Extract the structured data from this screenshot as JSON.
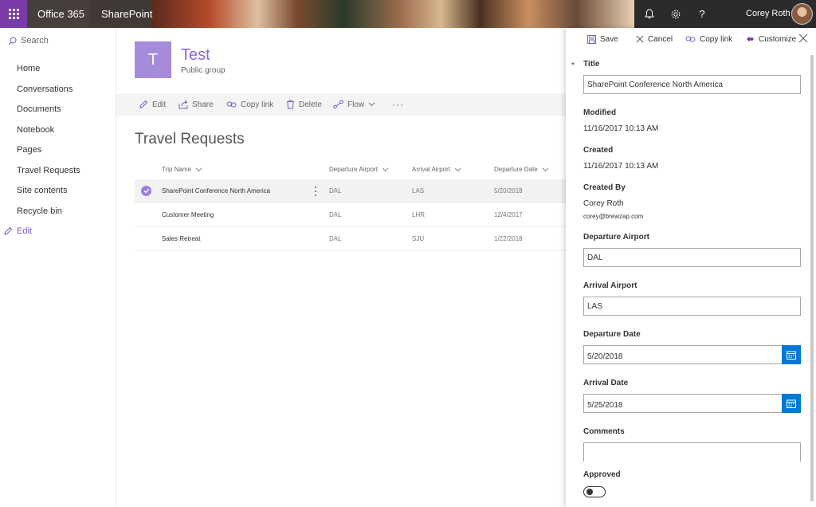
{
  "suite": {
    "brand": "Office 365",
    "app": "SharePoint",
    "user_name": "Corey Roth",
    "icons": [
      "waffle-icon",
      "bell-icon",
      "gear-icon",
      "help-icon"
    ]
  },
  "leftnav": {
    "search_label": "Search",
    "items": [
      {
        "label": "Home"
      },
      {
        "label": "Conversations"
      },
      {
        "label": "Documents"
      },
      {
        "label": "Notebook"
      },
      {
        "label": "Pages"
      },
      {
        "label": "Travel Requests"
      },
      {
        "label": "Site contents"
      },
      {
        "label": "Recycle bin"
      }
    ],
    "edit_label": "Edit"
  },
  "site": {
    "logo_letter": "T",
    "title": "Test",
    "subtitle": "Public group"
  },
  "commandbar": {
    "edit": "Edit",
    "share": "Share",
    "copy_link": "Copy link",
    "delete": "Delete",
    "flow": "Flow",
    "more": "···"
  },
  "list": {
    "title": "Travel Requests",
    "columns": [
      "Trip Name",
      "Departure Airport",
      "Arrival Airport",
      "Departure Date"
    ],
    "rows": [
      {
        "name": "SharePoint Conference North America",
        "departure": "DAL",
        "arrival": "LAS",
        "date": "5/20/2018",
        "selected": true
      },
      {
        "name": "Customer Meeting",
        "departure": "DAL",
        "arrival": "LHR",
        "date": "12/4/2017",
        "selected": false
      },
      {
        "name": "Sales Retreat",
        "departure": "DAL",
        "arrival": "SJU",
        "date": "1/22/2018",
        "selected": false
      }
    ]
  },
  "panel": {
    "commands": {
      "save": "Save",
      "cancel": "Cancel",
      "copy_link": "Copy link",
      "customize": "Customize"
    },
    "required_marker": "*",
    "title_label": "Title",
    "title_value": "SharePoint Conference North America",
    "modified_label": "Modified",
    "modified_value": "11/16/2017 10:13 AM",
    "created_label": "Created",
    "created_value": "11/16/2017 10:13 AM",
    "created_by_label": "Created By",
    "created_by_name": "Corey Roth",
    "created_by_email": "corey@brewzap.com",
    "departure_airport_label": "Departure Airport",
    "departure_airport_value": "DAL",
    "arrival_airport_label": "Arrival Airport",
    "arrival_airport_value": "LAS",
    "departure_date_label": "Departure Date",
    "departure_date_value": "5/20/2018",
    "arrival_date_label": "Arrival Date",
    "arrival_date_value": "5/25/2018",
    "comments_label": "Comments",
    "comments_value": "",
    "approved_label": "Approved",
    "approved_on": false
  },
  "colors": {
    "suite_waffle": "#7a3aa8",
    "accent_purple": "#8a6ad8",
    "logo_bg": "#a78bdb",
    "calendar_blue": "#0078d4"
  }
}
